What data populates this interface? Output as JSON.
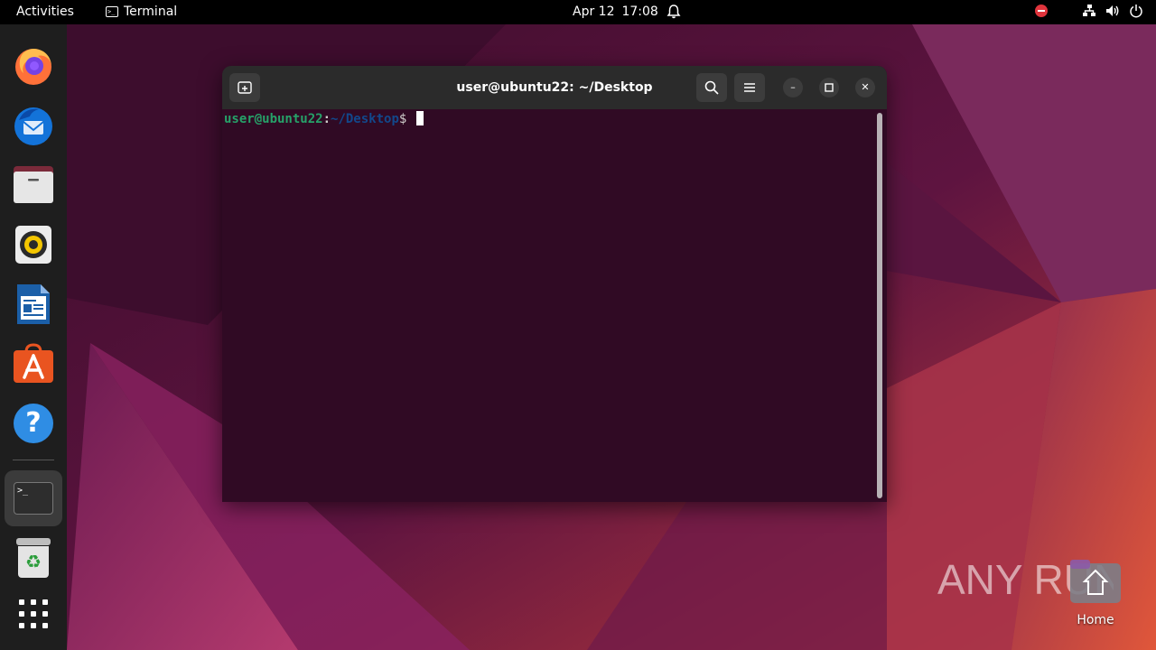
{
  "topbar": {
    "activities": "Activities",
    "app_name": "Terminal",
    "app_icon_glyph": ">_",
    "date": "Apr 12",
    "time": "17:08",
    "icons": [
      "bell-icon",
      "do-not-disturb-icon",
      "network-icon",
      "volume-icon",
      "power-icon"
    ]
  },
  "dock": {
    "items": [
      {
        "name": "Firefox",
        "icon": "firefox-icon"
      },
      {
        "name": "Thunderbird Mail",
        "icon": "thunderbird-icon"
      },
      {
        "name": "Files",
        "icon": "files-icon"
      },
      {
        "name": "Rhythmbox",
        "icon": "rhythmbox-icon"
      },
      {
        "name": "LibreOffice Writer",
        "icon": "writer-icon"
      },
      {
        "name": "Ubuntu Software",
        "icon": "software-icon"
      },
      {
        "name": "Help",
        "icon": "help-icon"
      },
      {
        "name": "Terminal",
        "icon": "terminal-icon",
        "running": true
      },
      {
        "name": "Trash",
        "icon": "trash-icon"
      },
      {
        "name": "Show Applications",
        "icon": "app-grid-icon"
      }
    ],
    "help_glyph": "?",
    "terminal_glyph": ">_",
    "trash_glyph": "♻"
  },
  "terminal": {
    "title": "user@ubuntu22: ~/Desktop",
    "prompt_user": "user@ubuntu22",
    "prompt_colon": ":",
    "prompt_path": "~/Desktop",
    "prompt_dollar": "$ ",
    "minimize_glyph": "–",
    "close_glyph": "✕"
  },
  "desktop": {
    "home_label": "Home"
  },
  "watermark": {
    "text": "ANY RUN"
  },
  "colors": {
    "accent": "#e95420",
    "terminal_bg": "#300a24",
    "prompt_user": "#26a269",
    "prompt_path": "#12488b"
  }
}
